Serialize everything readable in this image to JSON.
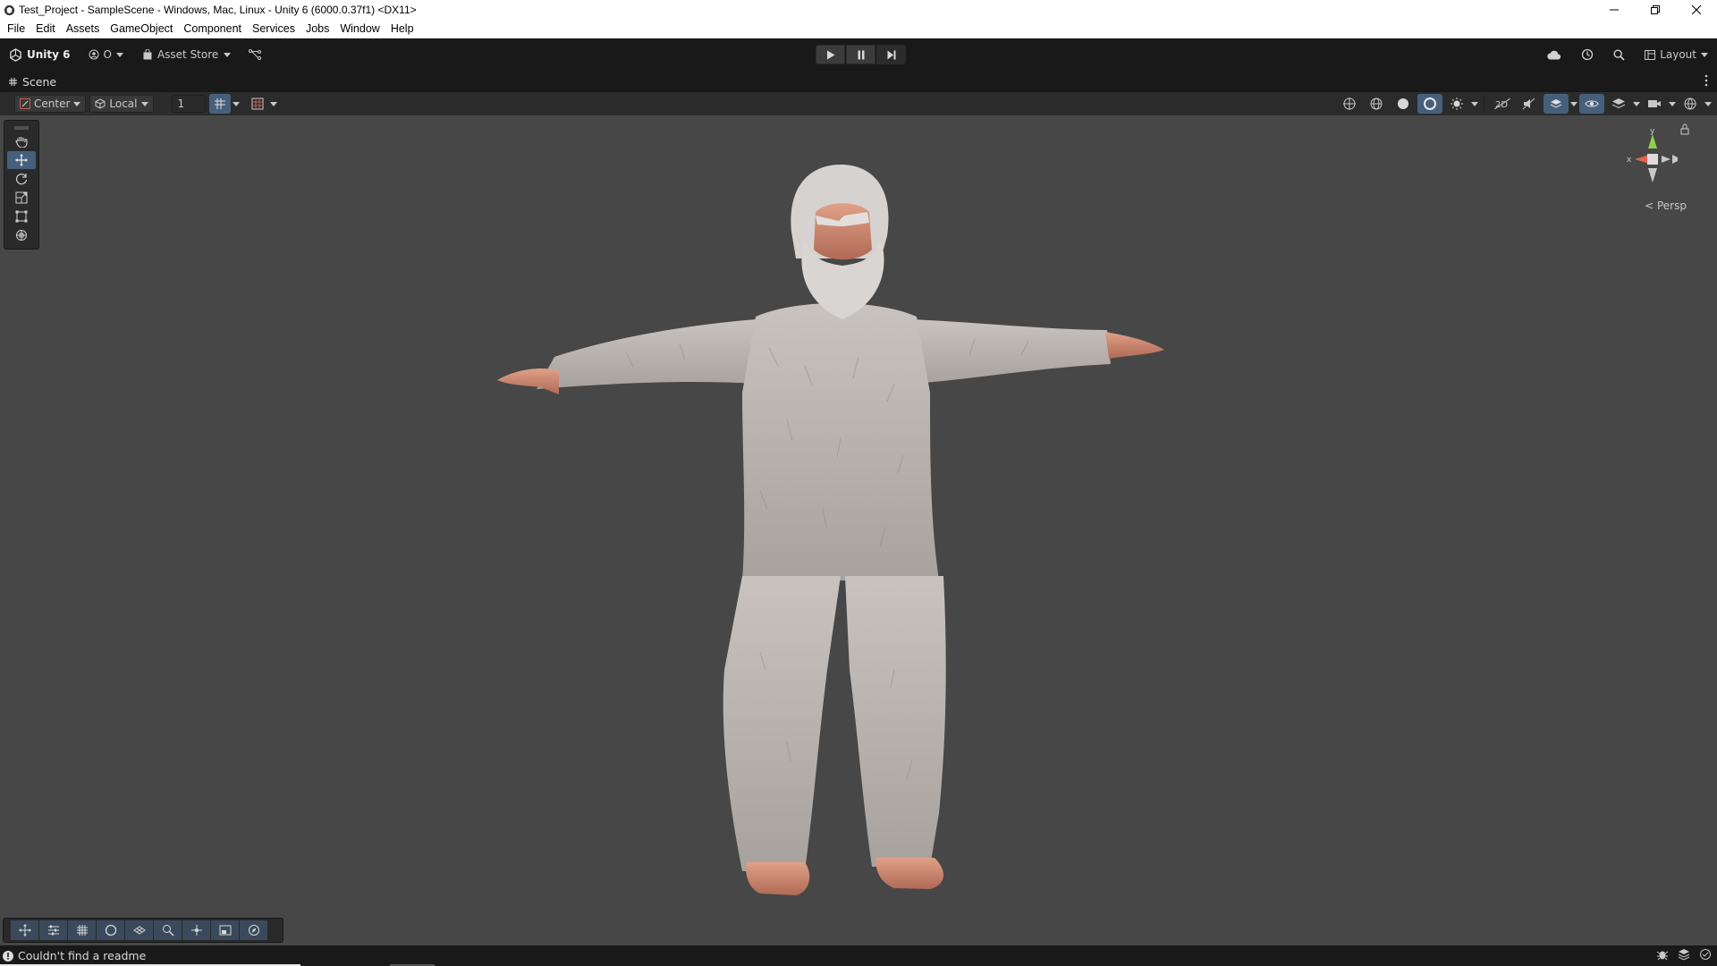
{
  "window": {
    "title": "Test_Project - SampleScene - Windows, Mac, Linux - Unity 6 (6000.0.37f1) <DX11>"
  },
  "menu": [
    "File",
    "Edit",
    "Assets",
    "GameObject",
    "Component",
    "Services",
    "Jobs",
    "Window",
    "Help"
  ],
  "toolbar": {
    "unity_label": "Unity 6",
    "account_label": "O",
    "asset_store_label": "Asset Store",
    "layout_label": "Layout"
  },
  "scene_tab": {
    "label": "Scene"
  },
  "scene_toolbar": {
    "pivot_label": "Center",
    "space_label": "Local",
    "grid_value": "1"
  },
  "gizmo": {
    "x_label": "x",
    "y_label": "y",
    "projection_label": "< Persp"
  },
  "status": {
    "message": "Couldn't find a readme"
  },
  "colors": {
    "accent": "#46607c",
    "scene_bg": "#474747",
    "chrome_bg": "#191919"
  }
}
